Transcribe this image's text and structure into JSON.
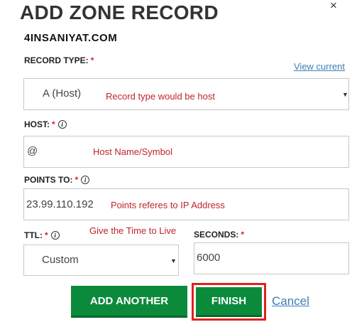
{
  "dialog": {
    "title": "ADD ZONE RECORD",
    "close_glyph": "×",
    "watermark": "4INSANIYAT.COM"
  },
  "record_type": {
    "label": "RECORD TYPE:",
    "required": "*",
    "view_current": "View current",
    "value": "A (Host)",
    "note": "Record type would be host"
  },
  "host": {
    "label": "HOST:",
    "required": "*",
    "info_glyph": "i",
    "value": "@",
    "note": "Host Name/Symbol"
  },
  "points_to": {
    "label": "POINTS TO:",
    "required": "*",
    "info_glyph": "i",
    "value": "23.99.110.192",
    "note": "Points referes to IP Address"
  },
  "ttl": {
    "label": "TTL:",
    "required": "*",
    "info_glyph": "i",
    "value": "Custom",
    "note": "Give the Time to Live"
  },
  "seconds": {
    "label": "SECONDS:",
    "required": "*",
    "value": "6000"
  },
  "actions": {
    "add_another": "ADD ANOTHER",
    "finish": "FINISH",
    "cancel": "Cancel"
  },
  "colors": {
    "button_green": "#0c8a3c",
    "highlight_red": "#e02020",
    "annotation_red": "#c0242b",
    "link_blue": "#3d7fb8"
  },
  "icons": {
    "close": "close-icon",
    "info": "info-icon",
    "dropdown": "chevron-down-icon"
  }
}
